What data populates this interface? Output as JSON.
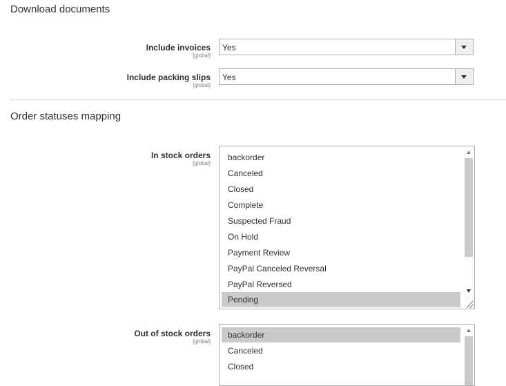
{
  "download_documents": {
    "title": "Download documents",
    "include_invoices": {
      "label": "Include invoices",
      "scope": "[global]",
      "value": "Yes"
    },
    "include_packing_slips": {
      "label": "Include packing slips",
      "scope": "[global]",
      "value": "Yes"
    }
  },
  "order_statuses_mapping": {
    "title": "Order statuses mapping",
    "in_stock_orders": {
      "label": "In stock orders",
      "scope": "[global]",
      "options": [
        "backorder",
        "Canceled",
        "Closed",
        "Complete",
        "Suspected Fraud",
        "On Hold",
        "Payment Review",
        "PayPal Canceled Reversal",
        "PayPal Reversed",
        "Pending"
      ],
      "selected": [
        "Pending"
      ]
    },
    "out_of_stock_orders": {
      "label": "Out of stock orders",
      "scope": "[global]",
      "options": [
        "backorder",
        "Canceled",
        "Closed"
      ],
      "selected": [
        "backorder"
      ]
    }
  }
}
